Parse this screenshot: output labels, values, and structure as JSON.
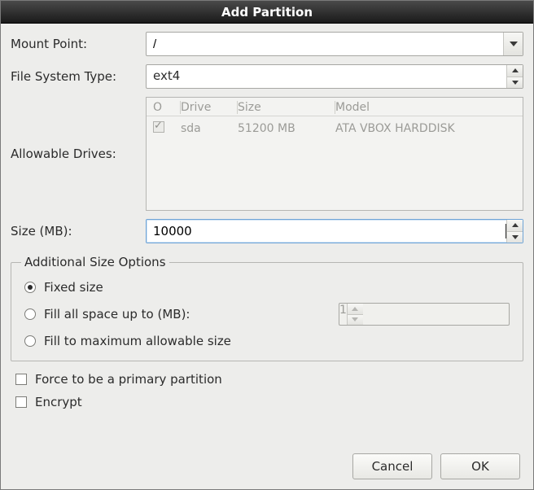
{
  "title": "Add Partition",
  "labels": {
    "mount_point": "Mount Point:",
    "fs_type": "File System Type:",
    "allowable_drives": "Allowable Drives:",
    "size_mb": "Size (MB):"
  },
  "mount_point": {
    "value": "/"
  },
  "fs_type": {
    "value": "ext4"
  },
  "drives": {
    "headers": {
      "checkbox": "O",
      "drive": "Drive",
      "size": "Size",
      "model": "Model"
    },
    "rows": [
      {
        "checked": true,
        "drive": "sda",
        "size": "51200 MB",
        "model": "ATA VBOX HARDDISK"
      }
    ]
  },
  "size": {
    "value": "10000"
  },
  "size_options": {
    "legend": "Additional Size Options",
    "fixed_label": "Fixed size",
    "fill_up_to_label": "Fill all space up to (MB):",
    "fill_up_to_value": "1",
    "fill_max_label": "Fill to maximum allowable size",
    "selected": "fixed"
  },
  "checkboxes": {
    "force_primary": "Force to be a primary partition",
    "encrypt": "Encrypt"
  },
  "buttons": {
    "cancel": "Cancel",
    "ok": "OK"
  }
}
